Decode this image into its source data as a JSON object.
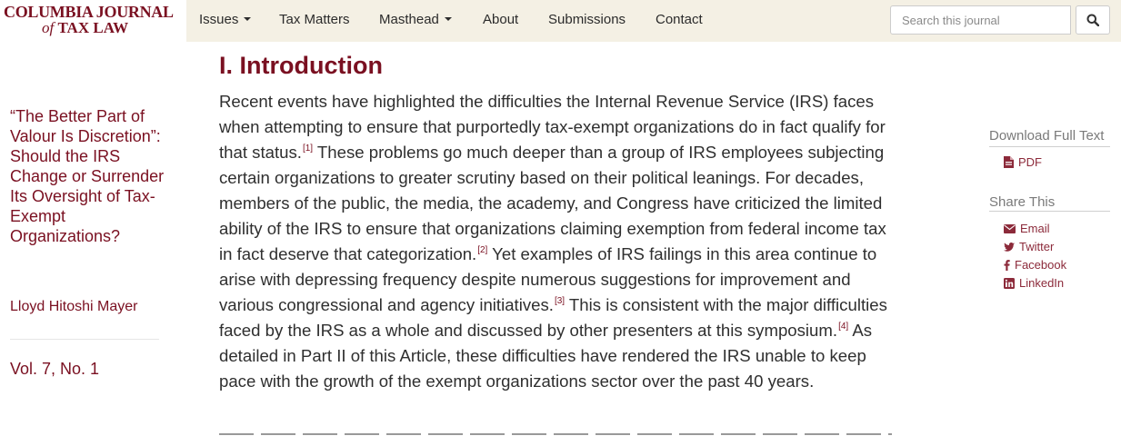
{
  "brand": {
    "line1": "COLUMBIA JOURNAL",
    "line2_italic": "of",
    "line2_bold": "TAX LAW"
  },
  "nav": {
    "issues": "Issues",
    "tax_matters": "Tax Matters",
    "masthead": "Masthead",
    "about": "About",
    "submissions": "Submissions",
    "contact": "Contact"
  },
  "search": {
    "placeholder": "Search this journal",
    "value": ""
  },
  "sidebar": {
    "title": "“The Better Part of Valour Is Discretion”: Should the IRS Change or Surrender Its Oversight of Tax-Exempt Organizations?",
    "author": "Lloyd Hitoshi Mayer",
    "volume": "Vol. 7, No. 1"
  },
  "article": {
    "heading": "I. Introduction",
    "seg1": "Recent events have highlighted the difficulties the Internal Revenue Service (IRS) faces when attempting to ensure that purportedly tax-exempt organizations do in fact qualify for that status.",
    "fn1": "[1]",
    "seg2": " These problems go much deeper than a group of IRS employees subjecting certain organizations to greater scrutiny based on their political leanings. For decades, members of the public, the media, the academy, and Congress have criticized the limited ability of the IRS to ensure that organizations claiming exemption from federal income tax in fact deserve that categorization.",
    "fn2": "[2]",
    "seg3": " Yet examples of IRS failings in this area continue to arise with depressing frequency despite numerous suggestions for improvement and various congressional and agency initiatives.",
    "fn3": "[3]",
    "seg4": " This is consistent with the major difficulties faced by the IRS as a whole and discussed by other presenters at this symposium.",
    "fn4": "[4]",
    "seg5": " As detailed in Part II of this Article, these difficulties have rendered the IRS unable to keep pace with the growth of the exempt organizations sector over the past 40 years."
  },
  "right": {
    "download_heading": "Download Full Text",
    "pdf": "PDF",
    "share_heading": "Share This",
    "email": "Email",
    "twitter": "Twitter",
    "facebook": "Facebook",
    "linkedin": "LinkedIn"
  },
  "colors": {
    "brand": "#7a1021",
    "nav_bg": "#f4f0e4",
    "link": "#8c2a3a"
  }
}
